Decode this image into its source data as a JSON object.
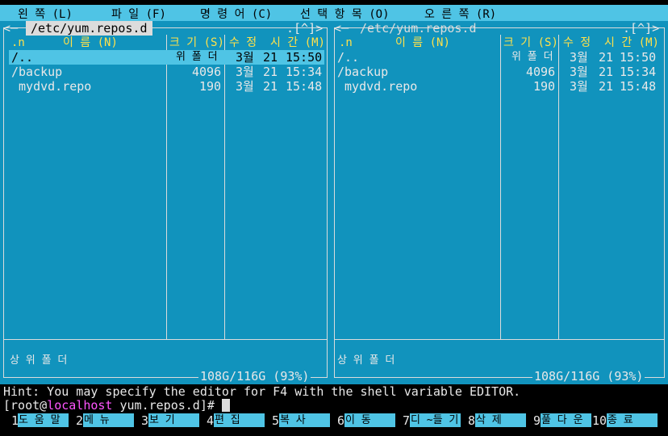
{
  "menu": [
    {
      "label": "왼 쪽 (L)"
    },
    {
      "label": "파 일 (F)"
    },
    {
      "label": "명 령 어 (C)"
    },
    {
      "label": "선 택 항 목 (O)"
    },
    {
      "label": "오 른 쪽 (R)"
    }
  ],
  "panels": {
    "left": {
      "path": "/etc/yum.repos.d",
      "corner": ".[^]>",
      "columns": {
        "sort": ".n",
        "name": "이 름 (N)",
        "size": "크 기 (S)",
        "mtime": "수 정  시 간 (M)"
      },
      "rows": [
        {
          "name": "/..",
          "size": "위 폴 더",
          "month": "3월",
          "day": "21",
          "time": "15:50",
          "selected": true
        },
        {
          "name": "/backup",
          "size": "4096",
          "month": "3월",
          "day": "21",
          "time": "15:34"
        },
        {
          "name": " mydvd.repo",
          "size": "190",
          "month": "3월",
          "day": "21",
          "time": "15:48"
        }
      ],
      "status": "상 위 폴 더",
      "disk": "108G/116G (93%)"
    },
    "right": {
      "path": "/etc/yum.repos.d",
      "corner": ".[^]>",
      "columns": {
        "sort": ".n",
        "name": "이 름 (N)",
        "size": "크 기 (S)",
        "mtime": "수 정  시 간 (M)"
      },
      "rows": [
        {
          "name": "/..",
          "size": "위 폴 더",
          "month": "3월",
          "day": "21",
          "time": "15:50"
        },
        {
          "name": "/backup",
          "size": "4096",
          "month": "3월",
          "day": "21",
          "time": "15:34"
        },
        {
          "name": " mydvd.repo",
          "size": "190",
          "month": "3월",
          "day": "21",
          "time": "15:48"
        }
      ],
      "status": "상 위 폴 더",
      "disk": "108G/116G (93%)"
    }
  },
  "hint": "Hint: You may specify the editor for F4 with the shell variable EDITOR.",
  "prompt": {
    "open": "[root@",
    "host": "localhost",
    "rest": " yum.repos.d]# "
  },
  "fkeys": [
    {
      "num": "1",
      "label": "도 움 말"
    },
    {
      "num": "2",
      "label": "메 뉴"
    },
    {
      "num": "3",
      "label": "보 기"
    },
    {
      "num": "4",
      "label": "편 집"
    },
    {
      "num": "5",
      "label": "복 사"
    },
    {
      "num": "6",
      "label": "이 동"
    },
    {
      "num": "7",
      "label": "디 ~들 기"
    },
    {
      "num": "8",
      "label": "삭 제"
    },
    {
      "num": "9",
      "label": "풀 다 운"
    },
    {
      "num": "10",
      "label": "종 료"
    }
  ],
  "colors": {
    "panel_bg": "#1193bd",
    "accent": "#4fc4e5",
    "header_text": "#ffe14a",
    "host_text": "#ff55ff"
  }
}
